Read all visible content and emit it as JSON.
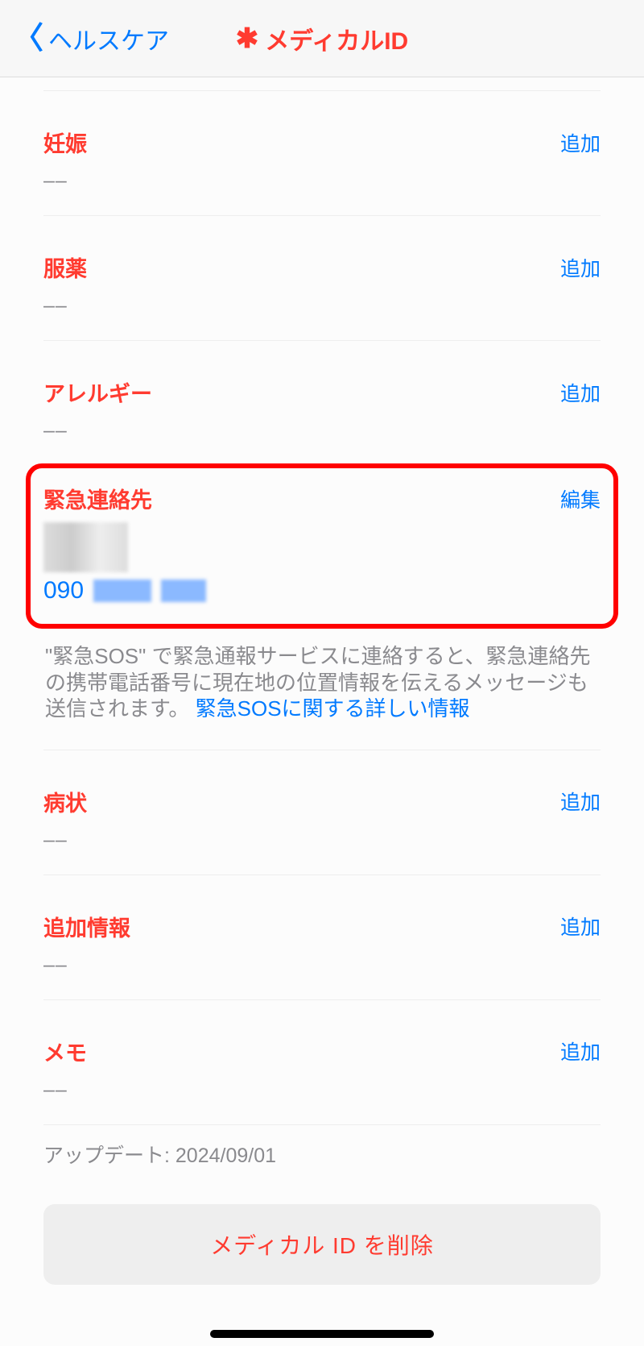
{
  "header": {
    "back_label": "ヘルスケア",
    "title": "メディカルID"
  },
  "sections": {
    "pregnancy": {
      "title": "妊娠",
      "action": "追加",
      "value": "––"
    },
    "medication": {
      "title": "服薬",
      "action": "追加",
      "value": "––"
    },
    "allergy": {
      "title": "アレルギー",
      "action": "追加",
      "value": "––"
    },
    "emergency_contact": {
      "title": "緊急連絡先",
      "action": "編集",
      "phone_prefix": "090"
    },
    "sos_info": {
      "text_part1": "\"緊急SOS\" で緊急通報サービスに連絡すると、緊急連絡先の携帯電話番号に現在地の位置情報を伝えるメッセージも送信されます。",
      "link": "緊急SOSに関する詳しい情報"
    },
    "condition": {
      "title": "病状",
      "action": "追加",
      "value": "––"
    },
    "additional_info": {
      "title": "追加情報",
      "action": "追加",
      "value": "––"
    },
    "memo": {
      "title": "メモ",
      "action": "追加",
      "value": "––"
    }
  },
  "update": {
    "label": "アップデート: ",
    "date": "2024/09/01"
  },
  "delete_button": "メディカル ID を削除"
}
